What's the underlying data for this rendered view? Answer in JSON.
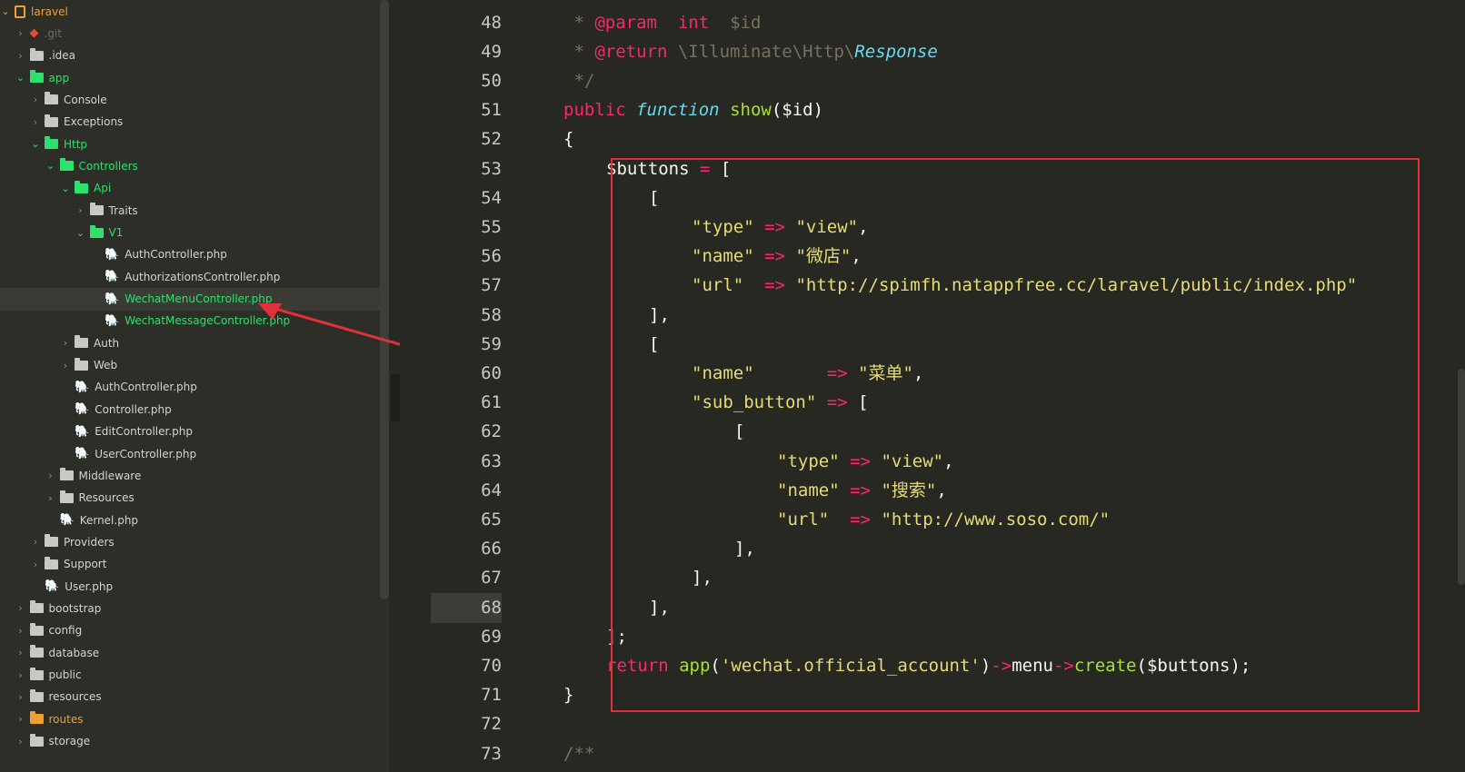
{
  "sidebar": {
    "items": [
      {
        "label": "laravel",
        "depth": 0,
        "icon": "laravel-logo-icon",
        "state": "open",
        "style": "orange"
      },
      {
        "label": ".git",
        "depth": 1,
        "icon": "git-icon",
        "state": "closed",
        "style": "dim"
      },
      {
        "label": ".idea",
        "depth": 1,
        "icon": "folder-icon",
        "state": "closed",
        "style": "normal"
      },
      {
        "label": "app",
        "depth": 1,
        "icon": "folder-icon",
        "state": "open",
        "style": "green"
      },
      {
        "label": "Console",
        "depth": 2,
        "icon": "folder-icon",
        "state": "closed",
        "style": "normal"
      },
      {
        "label": "Exceptions",
        "depth": 2,
        "icon": "folder-icon",
        "state": "closed",
        "style": "normal"
      },
      {
        "label": "Http",
        "depth": 2,
        "icon": "folder-icon",
        "state": "open",
        "style": "green"
      },
      {
        "label": "Controllers",
        "depth": 3,
        "icon": "folder-icon",
        "state": "open",
        "style": "green"
      },
      {
        "label": "Api",
        "depth": 4,
        "icon": "folder-icon",
        "state": "open",
        "style": "green"
      },
      {
        "label": "Traits",
        "depth": 5,
        "icon": "folder-icon",
        "state": "closed",
        "style": "normal"
      },
      {
        "label": "V1",
        "depth": 5,
        "icon": "folder-icon",
        "state": "open",
        "style": "green"
      },
      {
        "label": "AuthController.php",
        "depth": 6,
        "icon": "php-elephant-icon",
        "state": "file",
        "style": "normal"
      },
      {
        "label": "AuthorizationsController.php",
        "depth": 6,
        "icon": "php-elephant-icon",
        "state": "file",
        "style": "normal"
      },
      {
        "label": "WechatMenuController.php",
        "depth": 6,
        "icon": "php-elephant-icon",
        "state": "file",
        "style": "green",
        "selected": true
      },
      {
        "label": "WechatMessageController.php",
        "depth": 6,
        "icon": "php-elephant-icon",
        "state": "file",
        "style": "green"
      },
      {
        "label": "Auth",
        "depth": 4,
        "icon": "folder-icon",
        "state": "closed",
        "style": "normal"
      },
      {
        "label": "Web",
        "depth": 4,
        "icon": "folder-icon",
        "state": "closed",
        "style": "normal"
      },
      {
        "label": "AuthController.php",
        "depth": 4,
        "icon": "php-elephant-icon",
        "state": "file",
        "style": "normal"
      },
      {
        "label": "Controller.php",
        "depth": 4,
        "icon": "php-elephant-icon",
        "state": "file",
        "style": "normal"
      },
      {
        "label": "EditController.php",
        "depth": 4,
        "icon": "php-elephant-icon",
        "state": "file",
        "style": "normal"
      },
      {
        "label": "UserController.php",
        "depth": 4,
        "icon": "php-elephant-icon",
        "state": "file",
        "style": "normal"
      },
      {
        "label": "Middleware",
        "depth": 3,
        "icon": "folder-icon",
        "state": "closed",
        "style": "normal"
      },
      {
        "label": "Resources",
        "depth": 3,
        "icon": "folder-icon",
        "state": "closed",
        "style": "normal"
      },
      {
        "label": "Kernel.php",
        "depth": 3,
        "icon": "php-elephant-icon",
        "state": "file",
        "style": "normal"
      },
      {
        "label": "Providers",
        "depth": 2,
        "icon": "folder-icon",
        "state": "closed",
        "style": "normal"
      },
      {
        "label": "Support",
        "depth": 2,
        "icon": "folder-icon",
        "state": "closed",
        "style": "normal"
      },
      {
        "label": "User.php",
        "depth": 2,
        "icon": "php-elephant-icon",
        "state": "file",
        "style": "normal"
      },
      {
        "label": "bootstrap",
        "depth": 1,
        "icon": "folder-icon",
        "state": "closed",
        "style": "normal"
      },
      {
        "label": "config",
        "depth": 1,
        "icon": "folder-icon",
        "state": "closed",
        "style": "normal"
      },
      {
        "label": "database",
        "depth": 1,
        "icon": "folder-icon",
        "state": "closed",
        "style": "normal"
      },
      {
        "label": "public",
        "depth": 1,
        "icon": "folder-icon",
        "state": "closed",
        "style": "normal"
      },
      {
        "label": "resources",
        "depth": 1,
        "icon": "folder-icon",
        "state": "closed",
        "style": "normal"
      },
      {
        "label": "routes",
        "depth": 1,
        "icon": "folder-icon",
        "state": "closed",
        "style": "orange"
      },
      {
        "label": "storage",
        "depth": 1,
        "icon": "folder-icon",
        "state": "closed",
        "style": "normal"
      }
    ]
  },
  "editor": {
    "active_line": "68",
    "lines": [
      {
        "num": "48",
        "indent": 1,
        "tokens": [
          [
            "c",
            " * "
          ],
          [
            "k",
            "@param"
          ],
          [
            "p",
            "  "
          ],
          [
            "k",
            "int"
          ],
          [
            "p",
            "  "
          ],
          [
            "c",
            "$id"
          ]
        ]
      },
      {
        "num": "49",
        "indent": 1,
        "tokens": [
          [
            "c",
            " * "
          ],
          [
            "k",
            "@return"
          ],
          [
            "p",
            " "
          ],
          [
            "c",
            "\\Illuminate\\Http\\"
          ],
          [
            "s2",
            "Response"
          ]
        ]
      },
      {
        "num": "50",
        "indent": 1,
        "tokens": [
          [
            "c",
            " */"
          ]
        ]
      },
      {
        "num": "51",
        "indent": 1,
        "tokens": [
          [
            "k",
            "public"
          ],
          [
            "p",
            " "
          ],
          [
            "s2",
            "function"
          ],
          [
            "p",
            " "
          ],
          [
            "f",
            "show"
          ],
          [
            "p",
            "($id)"
          ]
        ]
      },
      {
        "num": "52",
        "indent": 1,
        "tokens": [
          [
            "p",
            "{"
          ]
        ]
      },
      {
        "num": "53",
        "indent": 2,
        "tokens": [
          [
            "p",
            "$buttons "
          ],
          [
            "o",
            "="
          ],
          [
            "p",
            " ["
          ]
        ]
      },
      {
        "num": "54",
        "indent": 3,
        "tokens": [
          [
            "p",
            "["
          ]
        ]
      },
      {
        "num": "55",
        "indent": 4,
        "tokens": [
          [
            "s",
            "\"type\""
          ],
          [
            "p",
            " "
          ],
          [
            "o",
            "=>"
          ],
          [
            "p",
            " "
          ],
          [
            "s",
            "\"view\""
          ],
          [
            "p",
            ","
          ]
        ]
      },
      {
        "num": "56",
        "indent": 4,
        "tokens": [
          [
            "s",
            "\"name\""
          ],
          [
            "p",
            " "
          ],
          [
            "o",
            "=>"
          ],
          [
            "p",
            " "
          ],
          [
            "s",
            "\"微店\""
          ],
          [
            "p",
            ","
          ]
        ]
      },
      {
        "num": "57",
        "indent": 4,
        "tokens": [
          [
            "s",
            "\"url\""
          ],
          [
            "p",
            "  "
          ],
          [
            "o",
            "=>"
          ],
          [
            "p",
            " "
          ],
          [
            "s",
            "\"http://spimfh.natappfree.cc/laravel/public/index.php\""
          ]
        ]
      },
      {
        "num": "58",
        "indent": 3,
        "tokens": [
          [
            "p",
            "],"
          ]
        ]
      },
      {
        "num": "59",
        "indent": 3,
        "tokens": [
          [
            "p",
            "["
          ]
        ]
      },
      {
        "num": "60",
        "indent": 4,
        "tokens": [
          [
            "s",
            "\"name\""
          ],
          [
            "p",
            "       "
          ],
          [
            "o",
            "=>"
          ],
          [
            "p",
            " "
          ],
          [
            "s",
            "\"菜单\""
          ],
          [
            "p",
            ","
          ]
        ]
      },
      {
        "num": "61",
        "indent": 4,
        "tokens": [
          [
            "s",
            "\"sub_button\""
          ],
          [
            "p",
            " "
          ],
          [
            "o",
            "=>"
          ],
          [
            "p",
            " ["
          ]
        ]
      },
      {
        "num": "62",
        "indent": 5,
        "tokens": [
          [
            "p",
            "["
          ]
        ]
      },
      {
        "num": "63",
        "indent": 6,
        "tokens": [
          [
            "s",
            "\"type\""
          ],
          [
            "p",
            " "
          ],
          [
            "o",
            "=>"
          ],
          [
            "p",
            " "
          ],
          [
            "s",
            "\"view\""
          ],
          [
            "p",
            ","
          ]
        ]
      },
      {
        "num": "64",
        "indent": 6,
        "tokens": [
          [
            "s",
            "\"name\""
          ],
          [
            "p",
            " "
          ],
          [
            "o",
            "=>"
          ],
          [
            "p",
            " "
          ],
          [
            "s",
            "\"搜索\""
          ],
          [
            "p",
            ","
          ]
        ]
      },
      {
        "num": "65",
        "indent": 6,
        "tokens": [
          [
            "s",
            "\"url\""
          ],
          [
            "p",
            "  "
          ],
          [
            "o",
            "=>"
          ],
          [
            "p",
            " "
          ],
          [
            "s",
            "\"http://www.soso.com/\""
          ]
        ]
      },
      {
        "num": "66",
        "indent": 5,
        "tokens": [
          [
            "p",
            "],"
          ]
        ]
      },
      {
        "num": "67",
        "indent": 4,
        "tokens": [
          [
            "p",
            "],"
          ]
        ]
      },
      {
        "num": "68",
        "indent": 3,
        "tokens": [
          [
            "p",
            "],"
          ]
        ]
      },
      {
        "num": "69",
        "indent": 2,
        "tokens": [
          [
            "p",
            "];"
          ]
        ]
      },
      {
        "num": "70",
        "indent": 2,
        "tokens": [
          [
            "k",
            "return"
          ],
          [
            "p",
            " "
          ],
          [
            "f",
            "app"
          ],
          [
            "p",
            "("
          ],
          [
            "s",
            "'wechat.official_account'"
          ],
          [
            "p",
            ")"
          ],
          [
            "o",
            "->"
          ],
          [
            "p",
            "menu"
          ],
          [
            "o",
            "->"
          ],
          [
            "f",
            "create"
          ],
          [
            "p",
            "($buttons);"
          ]
        ]
      },
      {
        "num": "71",
        "indent": 1,
        "tokens": [
          [
            "p",
            "}"
          ]
        ]
      },
      {
        "num": "72",
        "indent": 1,
        "tokens": []
      },
      {
        "num": "73",
        "indent": 1,
        "tokens": [
          [
            "c",
            "/**"
          ]
        ]
      }
    ]
  },
  "colors": {
    "highlight_box": "#e0303a",
    "annotation_arrow": "#e0303a",
    "folder_open": "#2ee06d",
    "folder_orange": "#f0a030"
  }
}
